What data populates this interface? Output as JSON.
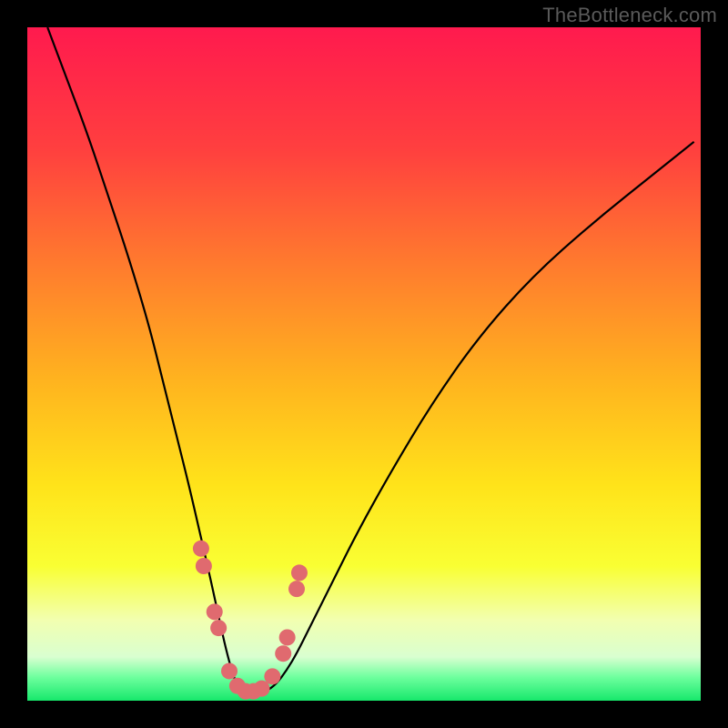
{
  "watermark": "TheBottleneck.com",
  "chart_data": {
    "type": "line",
    "title": "",
    "xlabel": "",
    "ylabel": "",
    "xlim": [
      0,
      100
    ],
    "ylim": [
      0,
      100
    ],
    "grid": false,
    "legend": false,
    "gradient": {
      "stops": [
        {
          "offset": 0.0,
          "color": "#ff1a4e"
        },
        {
          "offset": 0.18,
          "color": "#ff3f3f"
        },
        {
          "offset": 0.35,
          "color": "#ff7a2e"
        },
        {
          "offset": 0.52,
          "color": "#ffb21f"
        },
        {
          "offset": 0.68,
          "color": "#ffe31a"
        },
        {
          "offset": 0.8,
          "color": "#f9ff33"
        },
        {
          "offset": 0.88,
          "color": "#f2ffb0"
        },
        {
          "offset": 0.935,
          "color": "#d9ffd0"
        },
        {
          "offset": 0.965,
          "color": "#6eff9e"
        },
        {
          "offset": 1.0,
          "color": "#17e86b"
        }
      ]
    },
    "curve": {
      "stroke": "#000000",
      "width": 2.2,
      "x": [
        3.0,
        6.0,
        9.0,
        12.0,
        15.0,
        18.0,
        20.0,
        22.0,
        24.0,
        25.5,
        27.0,
        28.2,
        29.3,
        30.2,
        31.0,
        31.8,
        32.7,
        34.0,
        35.5,
        37.0,
        38.5,
        40.0,
        42.0,
        45.0,
        49.0,
        54.0,
        60.0,
        67.0,
        75.0,
        84.0,
        94.0,
        99.0
      ],
      "y": [
        100.0,
        92.0,
        84.0,
        75.0,
        66.0,
        56.0,
        48.0,
        40.0,
        32.0,
        25.5,
        19.0,
        13.5,
        8.5,
        5.0,
        2.6,
        1.4,
        1.0,
        1.0,
        1.4,
        2.5,
        4.5,
        7.0,
        11.0,
        17.0,
        25.0,
        34.0,
        44.0,
        54.0,
        63.0,
        71.0,
        79.0,
        83.0
      ]
    },
    "markers": {
      "fill": "#e06a6f",
      "radius": 9,
      "points": [
        {
          "x": 25.8,
          "y": 22.6
        },
        {
          "x": 26.2,
          "y": 20.0
        },
        {
          "x": 27.8,
          "y": 13.2
        },
        {
          "x": 28.4,
          "y": 10.8
        },
        {
          "x": 30.0,
          "y": 4.4
        },
        {
          "x": 31.2,
          "y": 2.2
        },
        {
          "x": 32.4,
          "y": 1.4
        },
        {
          "x": 33.6,
          "y": 1.4
        },
        {
          "x": 34.8,
          "y": 1.8
        },
        {
          "x": 36.4,
          "y": 3.6
        },
        {
          "x": 38.0,
          "y": 7.0
        },
        {
          "x": 38.6,
          "y": 9.4
        },
        {
          "x": 40.0,
          "y": 16.6
        },
        {
          "x": 40.4,
          "y": 19.0
        }
      ]
    }
  }
}
